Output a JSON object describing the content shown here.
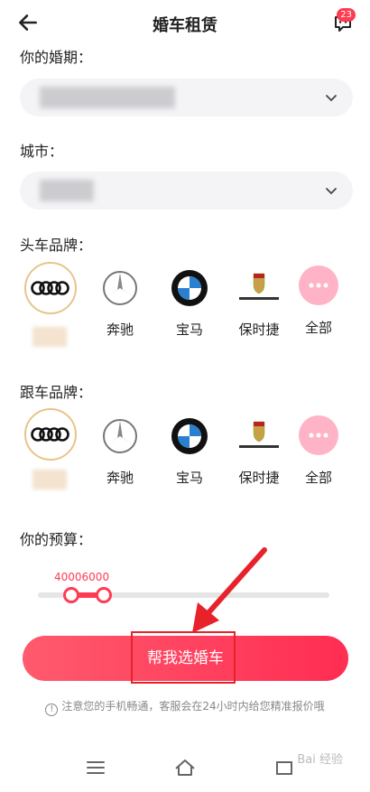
{
  "header": {
    "title": "婚车租赁",
    "badge": "23"
  },
  "wedding_date": {
    "label": "你的婚期："
  },
  "city": {
    "label": "城市："
  },
  "head_brand": {
    "label": "头车品牌：",
    "brands": [
      {
        "name": "",
        "icon": "audi-logo-icon"
      },
      {
        "name": "奔驰",
        "icon": "mercedes-logo-icon"
      },
      {
        "name": "宝马",
        "icon": "bmw-logo-icon"
      },
      {
        "name": "保时捷",
        "icon": "porsche-logo-icon"
      },
      {
        "name": "全部",
        "icon": "more-dots-icon"
      }
    ]
  },
  "follow_brand": {
    "label": "跟车品牌：",
    "brands": [
      {
        "name": "",
        "icon": "audi-logo-icon"
      },
      {
        "name": "奔驰",
        "icon": "mercedes-logo-icon"
      },
      {
        "name": "宝马",
        "icon": "bmw-logo-icon"
      },
      {
        "name": "保时捷",
        "icon": "porsche-logo-icon"
      },
      {
        "name": "全部",
        "icon": "more-dots-icon"
      }
    ]
  },
  "budget": {
    "label": "你的预算：",
    "range_text": "40006000",
    "min": 4000,
    "max": 6000
  },
  "cta": {
    "label": "帮我选婚车"
  },
  "note": {
    "text": "注意您的手机畅通，客服会在24小时内给您精准报价哦"
  },
  "watermark": {
    "text": "Bai 经验"
  },
  "colors": {
    "accent": "#ff3b52",
    "selected_border": "#e8c488",
    "pink": "#ffb3c6"
  }
}
